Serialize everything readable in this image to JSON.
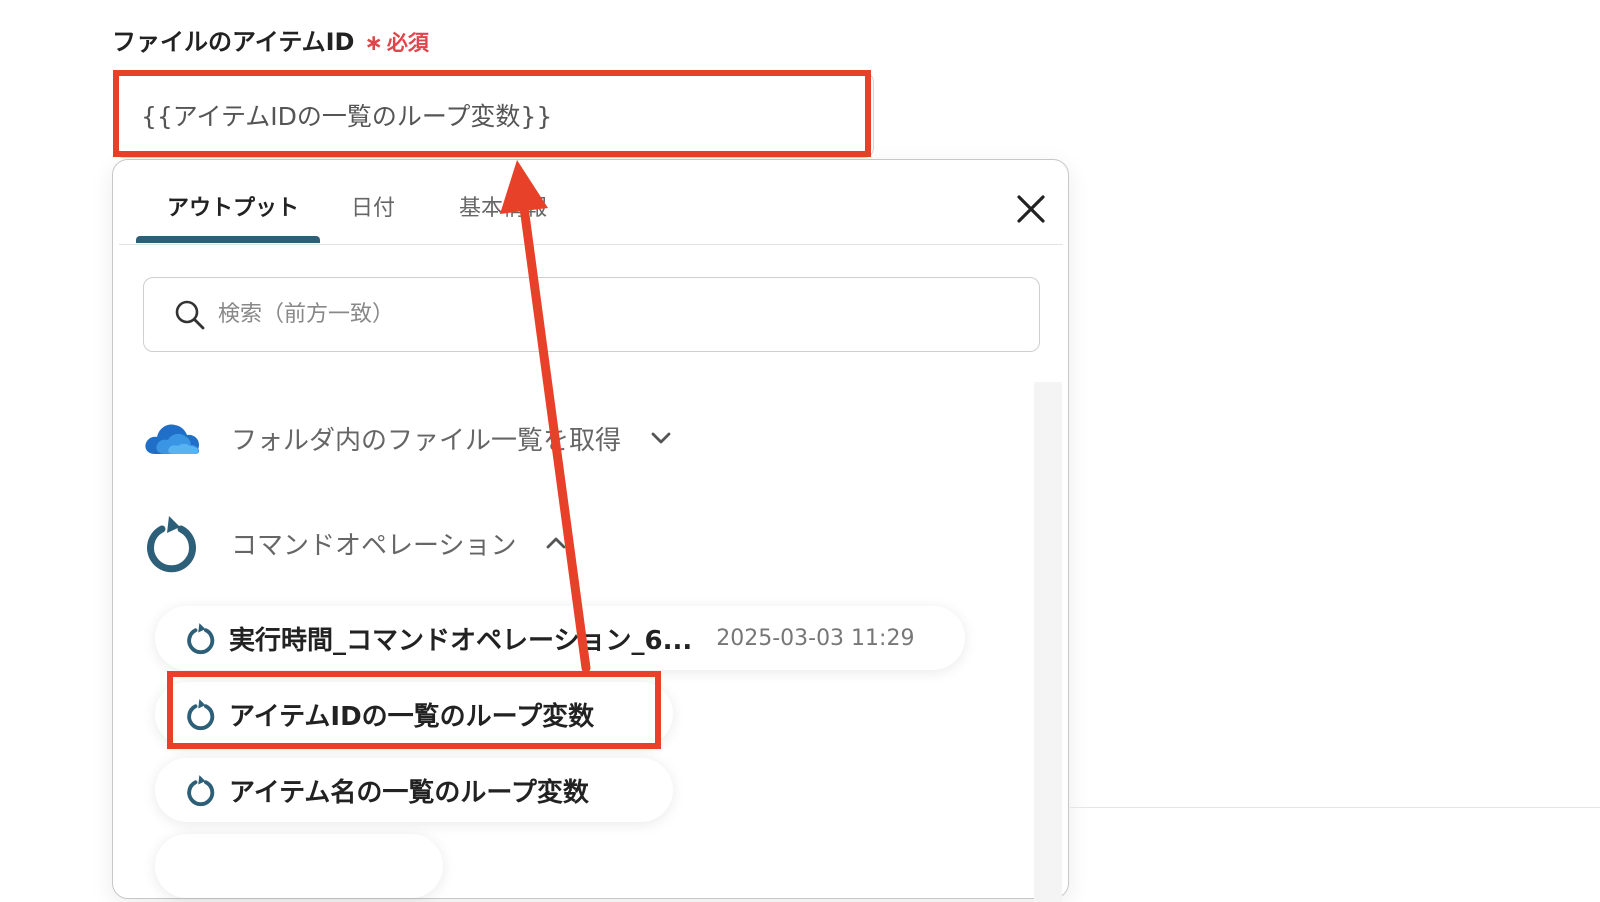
{
  "field": {
    "label": "ファイルのアイテムID",
    "required_mark": "∗",
    "required_text": "必須",
    "value": "{{アイテムIDの一覧のループ変数}}"
  },
  "popup": {
    "tabs": [
      {
        "label": "アウトプット",
        "active": true
      },
      {
        "label": "日付",
        "active": false
      },
      {
        "label": "基本情報",
        "active": false
      }
    ],
    "search": {
      "placeholder": "検索（前方一致）"
    },
    "sections": [
      {
        "label": "フォルダ内のファイル一覧を取得",
        "icon": "onedrive-cloud-icon",
        "expanded": false
      },
      {
        "label": "コマンドオペレーション",
        "icon": "loop-icon",
        "expanded": true
      }
    ],
    "items": [
      {
        "label": "実行時間_コマンドオペレーション_6...",
        "timestamp": "2025-03-03 11:29"
      },
      {
        "label": "アイテムIDの一覧のループ変数",
        "highlighted": true
      },
      {
        "label": "アイテム名の一覧のループ変数"
      }
    ]
  },
  "colors": {
    "annotation": "#e8412a",
    "tab_underline": "#2e5f78",
    "loop_icon": "#2e5f78",
    "required": "#e0454b"
  }
}
